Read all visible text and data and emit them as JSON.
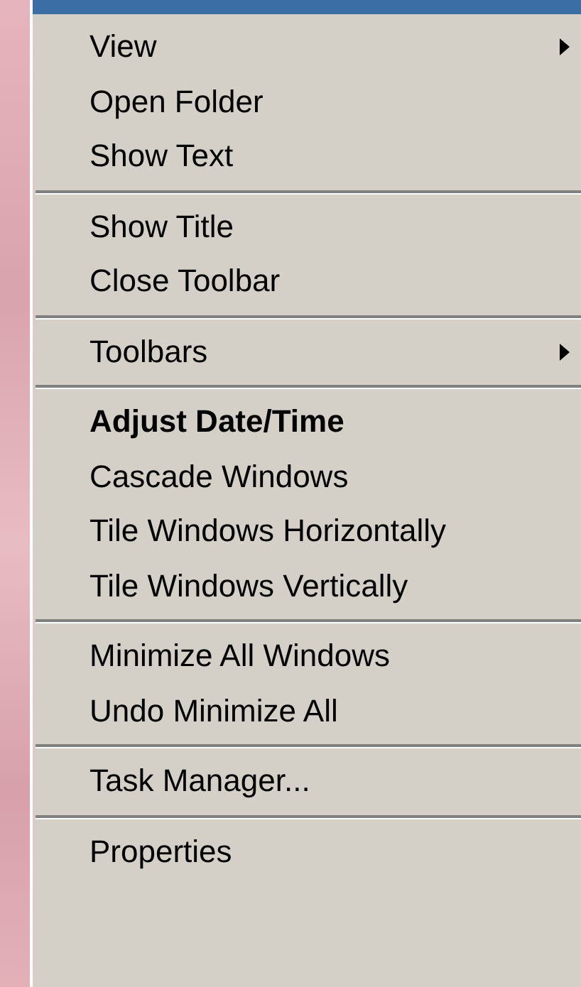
{
  "menu": {
    "highlighted_top": true,
    "groups": [
      [
        {
          "label": "View",
          "submenu": true,
          "default": false
        },
        {
          "label": "Open Folder",
          "submenu": false,
          "default": false
        },
        {
          "label": "Show Text",
          "submenu": false,
          "default": false
        }
      ],
      [
        {
          "label": "Show Title",
          "submenu": false,
          "default": false
        },
        {
          "label": "Close Toolbar",
          "submenu": false,
          "default": false
        }
      ],
      [
        {
          "label": "Toolbars",
          "submenu": true,
          "default": false
        }
      ],
      [
        {
          "label": "Adjust Date/Time",
          "submenu": false,
          "default": true
        },
        {
          "label": "Cascade Windows",
          "submenu": false,
          "default": false
        },
        {
          "label": "Tile Windows Horizontally",
          "submenu": false,
          "default": false
        },
        {
          "label": "Tile Windows Vertically",
          "submenu": false,
          "default": false
        }
      ],
      [
        {
          "label": "Minimize All Windows",
          "submenu": false,
          "default": false
        },
        {
          "label": "Undo Minimize All",
          "submenu": false,
          "default": false
        }
      ],
      [
        {
          "label": "Task Manager...",
          "submenu": false,
          "default": false
        }
      ],
      [
        {
          "label": "Properties",
          "submenu": false,
          "default": false
        }
      ]
    ]
  }
}
